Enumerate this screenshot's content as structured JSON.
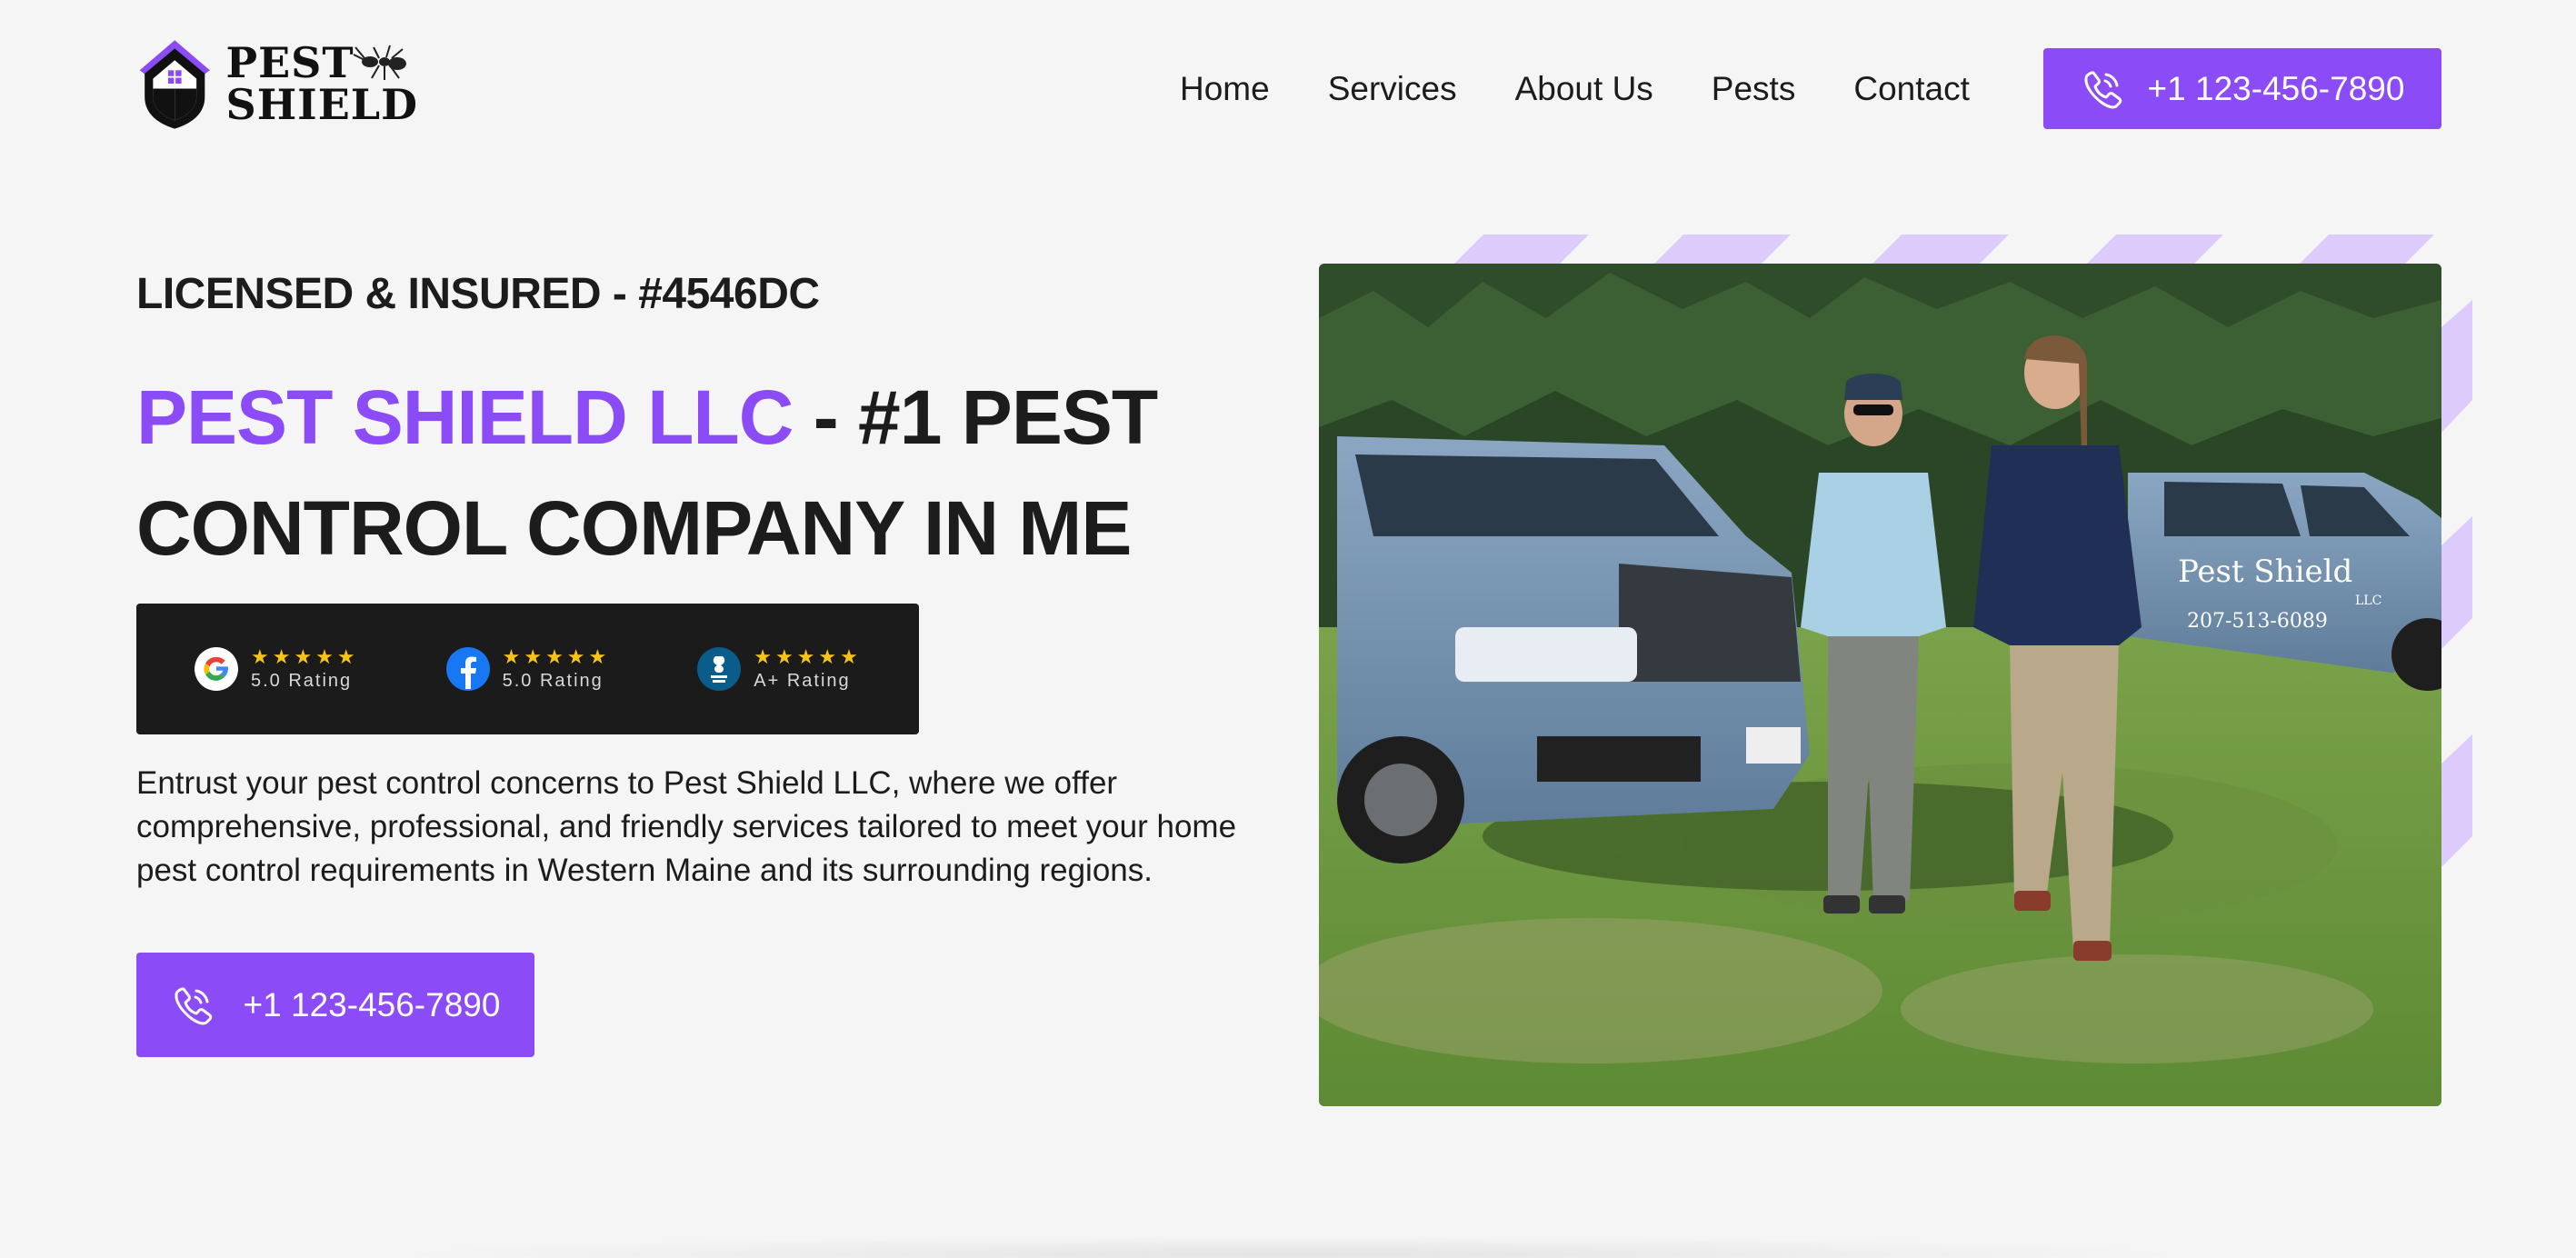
{
  "brand": {
    "logo_line1": "PEST",
    "logo_line2": "SHIELD",
    "accent_color": "#8b4cf7"
  },
  "nav": {
    "items": [
      "Home",
      "Services",
      "About Us",
      "Pests",
      "Contact"
    ]
  },
  "header": {
    "phone": "+1 123-456-7890",
    "phone_icon": "phone-icon"
  },
  "hero": {
    "licensed": "LICENSED & INSURED - #4546DC",
    "headline_accent": "PEST SHIELD LLC",
    "headline_rest": " - #1 PEST CONTROL COMPANY IN ME",
    "ratings": [
      {
        "source_icon": "google-icon",
        "stars": "★★★★★",
        "label": "5.0 Rating"
      },
      {
        "source_icon": "facebook-icon",
        "stars": "★★★★★",
        "label": "5.0 Rating"
      },
      {
        "source_icon": "bbb-icon",
        "stars": "★★★★★",
        "label": "A+ Rating"
      }
    ],
    "intro": "Entrust your pest control concerns to Pest Shield LLC, where we offer comprehensive, professional, and friendly services tailored to meet your home pest control requirements in Western Maine and its surrounding regions.",
    "phone": "+1 123-456-7890",
    "photo_truck_text": "Pest Shield",
    "photo_truck_llc": "LLC",
    "photo_truck_phone": "207-513-6089"
  }
}
